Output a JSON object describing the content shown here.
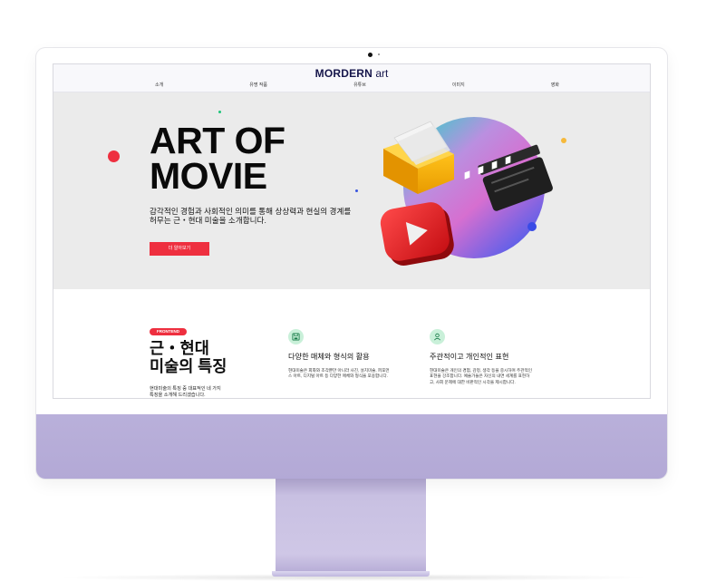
{
  "nav": {
    "brand_bold": "MORDERN",
    "brand_light": " art",
    "menu": [
      "소개",
      "유명 작품",
      "유튜브",
      "이미지",
      "영화"
    ]
  },
  "hero": {
    "title_line1": "ART OF",
    "title_line2": "MOVIE",
    "desc_line1": "감각적인 경험과 사회적인 의미를 통해 상상력과 현실의 경계를",
    "desc_line2": "허무는 근・현대 미술을 소개합니다.",
    "cta_label": "더 알아보기"
  },
  "features": {
    "badge": "FRONTEND",
    "title_line1": "근・현대",
    "title_line2": "미술의 특징",
    "desc_line1": "현대미술의 특징 중 대표적인 네 가지",
    "desc_line2": "특징을 소개해 드리겠습니다.",
    "cards": [
      {
        "icon": "floppy-disk-icon",
        "title": "다양한 매체와 형식의 활용",
        "line1": "현대미술은 회화와 조각뿐만 아니라 사진, 설치미술, 퍼포먼",
        "line2": "스 아트, 디지털 아트 등 다양한 매체와 형식을 포용합니다."
      },
      {
        "icon": "user-icon",
        "title": "주관적이고 개인적인 표현",
        "line1": "현대미술은 개인의 경험, 감정, 생각 등을 중시하며 주관적인",
        "line2": "표현을 강조합니다. 예술가들은 자신의 내면 세계를 표현하",
        "line3": "고, 사회 문제에 대한 비판적인 시각을 제시합니다."
      }
    ]
  },
  "colors": {
    "accent": "#ee2f3f",
    "brand_navy": "#15154a",
    "hero_bg": "#ebebeb",
    "icon_bg": "#c9f0d9",
    "monitor_chin": "#b9b0da"
  }
}
